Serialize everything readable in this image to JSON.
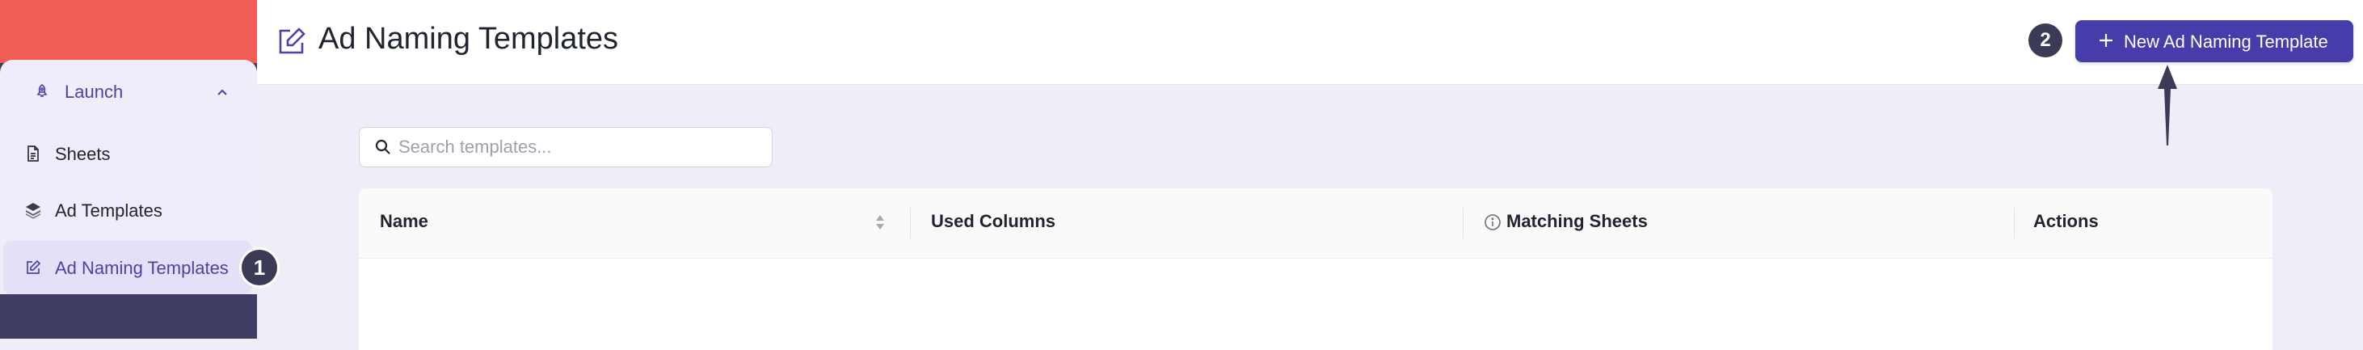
{
  "sidebar": {
    "group": {
      "label": "Launch",
      "icon": "rocket-icon"
    },
    "items": [
      {
        "label": "Sheets",
        "icon": "document-icon"
      },
      {
        "label": "Ad Templates",
        "icon": "layers-icon"
      },
      {
        "label": "Ad Naming Templates",
        "icon": "edit-icon",
        "active": true
      }
    ]
  },
  "header": {
    "title": "Ad Naming Templates",
    "new_button_label": "New Ad Naming Template"
  },
  "callouts": {
    "first": "1",
    "second": "2"
  },
  "search": {
    "placeholder": "Search templates...",
    "value": ""
  },
  "table": {
    "columns": [
      "Name",
      "Used Columns",
      "Matching Sheets",
      "Actions"
    ]
  },
  "colors": {
    "accent": "#463dab",
    "sidebar_top": "#ef5d54",
    "sidebar_bottom": "#3f3d63",
    "content_bg": "#efeef8"
  }
}
